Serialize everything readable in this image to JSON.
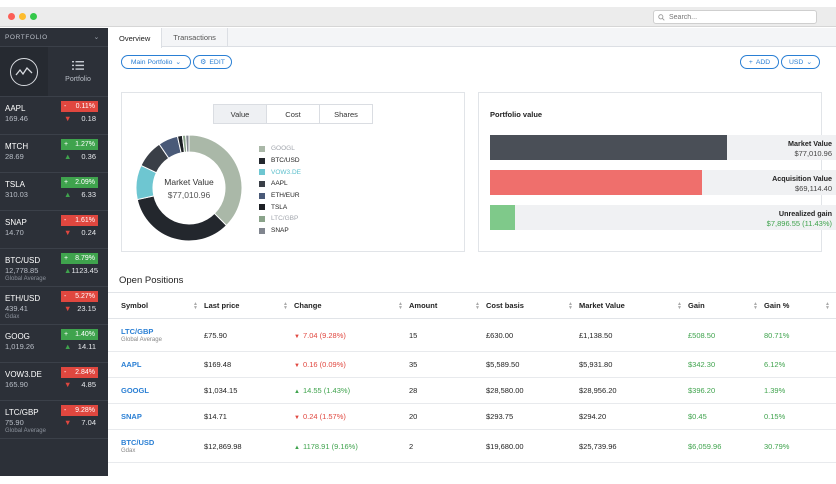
{
  "window": {
    "search_placeholder": "Search..."
  },
  "sidebar": {
    "header": "PORTFOLIO",
    "view_label": "Portfolio",
    "tickers": [
      {
        "symbol": "AAPL",
        "price": "169.46",
        "sub": "",
        "pct": "0.11%",
        "pct_dir": "down",
        "change": "0.18",
        "change_dir": "down"
      },
      {
        "symbol": "MTCH",
        "price": "28.69",
        "sub": "",
        "pct": "1.27%",
        "pct_dir": "up",
        "change": "0.36",
        "change_dir": "up"
      },
      {
        "symbol": "TSLA",
        "price": "310.03",
        "sub": "",
        "pct": "2.09%",
        "pct_dir": "up",
        "change": "6.33",
        "change_dir": "up"
      },
      {
        "symbol": "SNAP",
        "price": "14.70",
        "sub": "",
        "pct": "1.61%",
        "pct_dir": "down",
        "change": "0.24",
        "change_dir": "down"
      },
      {
        "symbol": "BTC/USD",
        "price": "12,778.85",
        "sub": "Global Average",
        "pct": "8.79%",
        "pct_dir": "up",
        "change": "1123.45",
        "change_dir": "up"
      },
      {
        "symbol": "ETH/USD",
        "price": "439.41",
        "sub": "Gdax",
        "pct": "5.27%",
        "pct_dir": "down",
        "change": "23.15",
        "change_dir": "down"
      },
      {
        "symbol": "GOOG",
        "price": "1,019.26",
        "sub": "",
        "pct": "1.40%",
        "pct_dir": "up",
        "change": "14.11",
        "change_dir": "up"
      },
      {
        "symbol": "VOW3.DE",
        "price": "165.90",
        "sub": "",
        "pct": "2.84%",
        "pct_dir": "down",
        "change": "4.85",
        "change_dir": "down"
      },
      {
        "symbol": "LTC/GBP",
        "price": "75.90",
        "sub": "Global Average",
        "pct": "9.28%",
        "pct_dir": "down",
        "change": "7.04",
        "change_dir": "down"
      }
    ]
  },
  "tabs": [
    "Overview",
    "Transactions"
  ],
  "toolbar": {
    "portfolio_select": "Main Portfolio",
    "edit_label": "EDIT",
    "add_label": "ADD",
    "currency": "USD"
  },
  "allocation": {
    "segments": [
      "Value",
      "Cost",
      "Shares"
    ],
    "active_segment": "Value",
    "center_label": "Market Value",
    "center_value": "$77,010.96",
    "slices": [
      {
        "name": "GOOGL",
        "share": 0.375,
        "color": "#aab8a8",
        "text_color": "#a2a6ad"
      },
      {
        "name": "BTC/USD",
        "share": 0.34,
        "color": "#23272d",
        "text_color": "#222222"
      },
      {
        "name": "VOW3.DE",
        "share": 0.105,
        "color": "#6ec6d1",
        "text_color": "#5bbfcc"
      },
      {
        "name": "AAPL",
        "share": 0.085,
        "color": "#3a3f47",
        "text_color": "#222222"
      },
      {
        "name": "ETH/EUR",
        "share": 0.06,
        "color": "#4a5a78",
        "text_color": "#222222"
      },
      {
        "name": "TSLA",
        "share": 0.015,
        "color": "#1c1f24",
        "text_color": "#222222"
      },
      {
        "name": "LTC/GBP",
        "share": 0.01,
        "color": "#8aa38a",
        "text_color": "#a2a6ad"
      },
      {
        "name": "SNAP",
        "share": 0.01,
        "color": "#80858e",
        "text_color": "#222222"
      }
    ]
  },
  "portfolio_value": {
    "title": "Portfolio value",
    "rows": [
      {
        "label": "Market Value",
        "value": "$77,010.96",
        "fraction": 0.685,
        "color": "#4a4f57",
        "value_color": "#444444"
      },
      {
        "label": "Acquisition Value",
        "value": "$69,114.40",
        "fraction": 0.614,
        "color": "#ef6f6c",
        "value_color": "#444444"
      },
      {
        "label": "Unrealized gain",
        "value": "$7,896.55 (11.43%)",
        "fraction": 0.071,
        "color": "#7fc98a",
        "value_color": "#3fa34d"
      }
    ]
  },
  "positions": {
    "title": "Open Positions",
    "columns": [
      "Symbol",
      "Last price",
      "Change",
      "Amount",
      "Cost basis",
      "Market Value",
      "Gain",
      "Gain %"
    ],
    "rows": [
      {
        "symbol": "LTC/GBP",
        "sub": "Global Average",
        "last": "£75.90",
        "change": "7.04 (9.28%)",
        "dir": "down",
        "amount": "15",
        "cost": "£630.00",
        "market": "£1,138.50",
        "gain": "£508.50",
        "gain_pct": "80.71%"
      },
      {
        "symbol": "AAPL",
        "sub": "",
        "last": "$169.48",
        "change": "0.16 (0.09%)",
        "dir": "down",
        "amount": "35",
        "cost": "$5,589.50",
        "market": "$5,931.80",
        "gain": "$342.30",
        "gain_pct": "6.12%"
      },
      {
        "symbol": "GOOGL",
        "sub": "",
        "last": "$1,034.15",
        "change": "14.55 (1.43%)",
        "dir": "up",
        "amount": "28",
        "cost": "$28,580.00",
        "market": "$28,956.20",
        "gain": "$396.20",
        "gain_pct": "1.39%"
      },
      {
        "symbol": "SNAP",
        "sub": "",
        "last": "$14.71",
        "change": "0.24 (1.57%)",
        "dir": "down",
        "amount": "20",
        "cost": "$293.75",
        "market": "$294.20",
        "gain": "$0.45",
        "gain_pct": "0.15%"
      },
      {
        "symbol": "BTC/USD",
        "sub": "Gdax",
        "last": "$12,869.98",
        "change": "1178.91 (9.16%)",
        "dir": "up",
        "amount": "2",
        "cost": "$19,680.00",
        "market": "$25,739.96",
        "gain": "$6,059.96",
        "gain_pct": "30.79%"
      }
    ]
  }
}
